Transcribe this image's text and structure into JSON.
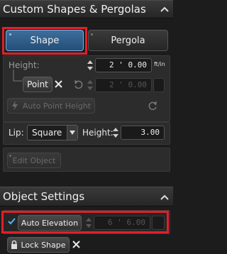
{
  "custom_shapes": {
    "title": "Custom Shapes & Pergolas",
    "tab_shape": "Shape",
    "tab_pergola": "Pergola",
    "height_label": "Height:",
    "height_value": "2 ' 0.00",
    "height_unit": "ft/in",
    "point_label": "Point",
    "point_value": "2 ' 0.00",
    "auto_point_height_label": "Auto Point Height",
    "lip_label": "Lip:",
    "lip_selected": "Square",
    "lip_height_label": "Height:",
    "lip_height_value": "3.00",
    "edit_object_label": "Edit Object"
  },
  "object_settings": {
    "title": "Object Settings",
    "auto_elevation_label": "Auto Elevation",
    "auto_elevation_checked": true,
    "elevation_value": "6 ' 6.00",
    "lock_shape_label": "Lock Shape"
  },
  "colors": {
    "highlight": "#e0202a",
    "accent": "#3f6e9c",
    "check": "#4fb4ff"
  }
}
